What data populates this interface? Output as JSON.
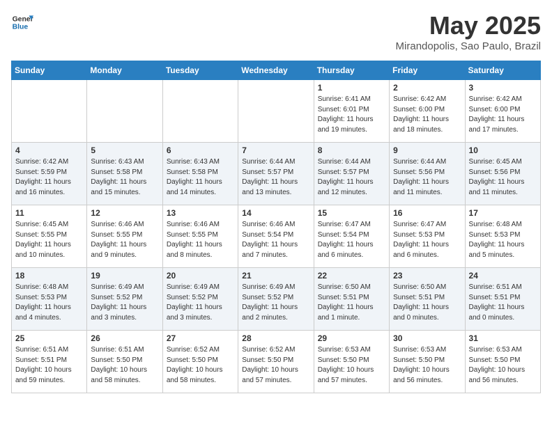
{
  "header": {
    "logo_general": "General",
    "logo_blue": "Blue",
    "month_title": "May 2025",
    "location": "Mirandopolis, Sao Paulo, Brazil"
  },
  "weekdays": [
    "Sunday",
    "Monday",
    "Tuesday",
    "Wednesday",
    "Thursday",
    "Friday",
    "Saturday"
  ],
  "weeks": [
    [
      {
        "day": "",
        "content": ""
      },
      {
        "day": "",
        "content": ""
      },
      {
        "day": "",
        "content": ""
      },
      {
        "day": "",
        "content": ""
      },
      {
        "day": "1",
        "content": "Sunrise: 6:41 AM\nSunset: 6:01 PM\nDaylight: 11 hours and 19 minutes."
      },
      {
        "day": "2",
        "content": "Sunrise: 6:42 AM\nSunset: 6:00 PM\nDaylight: 11 hours and 18 minutes."
      },
      {
        "day": "3",
        "content": "Sunrise: 6:42 AM\nSunset: 6:00 PM\nDaylight: 11 hours and 17 minutes."
      }
    ],
    [
      {
        "day": "4",
        "content": "Sunrise: 6:42 AM\nSunset: 5:59 PM\nDaylight: 11 hours and 16 minutes."
      },
      {
        "day": "5",
        "content": "Sunrise: 6:43 AM\nSunset: 5:58 PM\nDaylight: 11 hours and 15 minutes."
      },
      {
        "day": "6",
        "content": "Sunrise: 6:43 AM\nSunset: 5:58 PM\nDaylight: 11 hours and 14 minutes."
      },
      {
        "day": "7",
        "content": "Sunrise: 6:44 AM\nSunset: 5:57 PM\nDaylight: 11 hours and 13 minutes."
      },
      {
        "day": "8",
        "content": "Sunrise: 6:44 AM\nSunset: 5:57 PM\nDaylight: 11 hours and 12 minutes."
      },
      {
        "day": "9",
        "content": "Sunrise: 6:44 AM\nSunset: 5:56 PM\nDaylight: 11 hours and 11 minutes."
      },
      {
        "day": "10",
        "content": "Sunrise: 6:45 AM\nSunset: 5:56 PM\nDaylight: 11 hours and 11 minutes."
      }
    ],
    [
      {
        "day": "11",
        "content": "Sunrise: 6:45 AM\nSunset: 5:55 PM\nDaylight: 11 hours and 10 minutes."
      },
      {
        "day": "12",
        "content": "Sunrise: 6:46 AM\nSunset: 5:55 PM\nDaylight: 11 hours and 9 minutes."
      },
      {
        "day": "13",
        "content": "Sunrise: 6:46 AM\nSunset: 5:55 PM\nDaylight: 11 hours and 8 minutes."
      },
      {
        "day": "14",
        "content": "Sunrise: 6:46 AM\nSunset: 5:54 PM\nDaylight: 11 hours and 7 minutes."
      },
      {
        "day": "15",
        "content": "Sunrise: 6:47 AM\nSunset: 5:54 PM\nDaylight: 11 hours and 6 minutes."
      },
      {
        "day": "16",
        "content": "Sunrise: 6:47 AM\nSunset: 5:53 PM\nDaylight: 11 hours and 6 minutes."
      },
      {
        "day": "17",
        "content": "Sunrise: 6:48 AM\nSunset: 5:53 PM\nDaylight: 11 hours and 5 minutes."
      }
    ],
    [
      {
        "day": "18",
        "content": "Sunrise: 6:48 AM\nSunset: 5:53 PM\nDaylight: 11 hours and 4 minutes."
      },
      {
        "day": "19",
        "content": "Sunrise: 6:49 AM\nSunset: 5:52 PM\nDaylight: 11 hours and 3 minutes."
      },
      {
        "day": "20",
        "content": "Sunrise: 6:49 AM\nSunset: 5:52 PM\nDaylight: 11 hours and 3 minutes."
      },
      {
        "day": "21",
        "content": "Sunrise: 6:49 AM\nSunset: 5:52 PM\nDaylight: 11 hours and 2 minutes."
      },
      {
        "day": "22",
        "content": "Sunrise: 6:50 AM\nSunset: 5:51 PM\nDaylight: 11 hours and 1 minute."
      },
      {
        "day": "23",
        "content": "Sunrise: 6:50 AM\nSunset: 5:51 PM\nDaylight: 11 hours and 0 minutes."
      },
      {
        "day": "24",
        "content": "Sunrise: 6:51 AM\nSunset: 5:51 PM\nDaylight: 11 hours and 0 minutes."
      }
    ],
    [
      {
        "day": "25",
        "content": "Sunrise: 6:51 AM\nSunset: 5:51 PM\nDaylight: 10 hours and 59 minutes."
      },
      {
        "day": "26",
        "content": "Sunrise: 6:51 AM\nSunset: 5:50 PM\nDaylight: 10 hours and 58 minutes."
      },
      {
        "day": "27",
        "content": "Sunrise: 6:52 AM\nSunset: 5:50 PM\nDaylight: 10 hours and 58 minutes."
      },
      {
        "day": "28",
        "content": "Sunrise: 6:52 AM\nSunset: 5:50 PM\nDaylight: 10 hours and 57 minutes."
      },
      {
        "day": "29",
        "content": "Sunrise: 6:53 AM\nSunset: 5:50 PM\nDaylight: 10 hours and 57 minutes."
      },
      {
        "day": "30",
        "content": "Sunrise: 6:53 AM\nSunset: 5:50 PM\nDaylight: 10 hours and 56 minutes."
      },
      {
        "day": "31",
        "content": "Sunrise: 6:53 AM\nSunset: 5:50 PM\nDaylight: 10 hours and 56 minutes."
      }
    ]
  ]
}
